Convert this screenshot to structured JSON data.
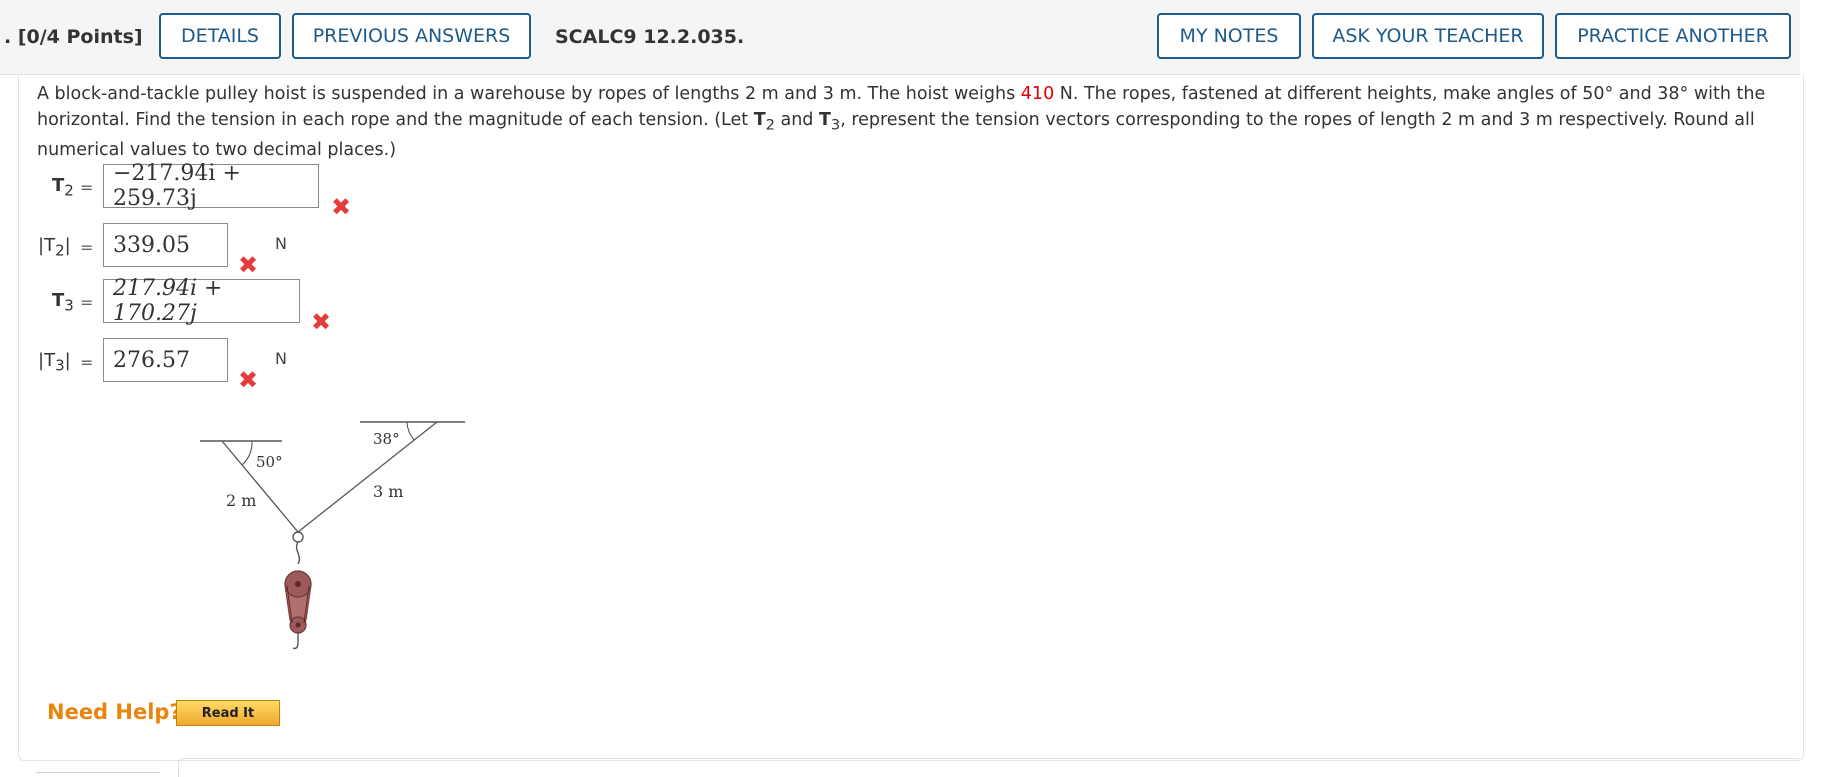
{
  "header": {
    "points": ". [0/4 Points]",
    "details_label": "DETAILS",
    "previous_answers_label": "PREVIOUS ANSWERS",
    "question_id": "SCALC9 12.2.035.",
    "my_notes_label": "MY NOTES",
    "ask_teacher_label": "ASK YOUR TEACHER",
    "practice_another_label": "PRACTICE ANOTHER"
  },
  "problem": {
    "text_part1": "A block-and-tackle pulley hoist is suspended in a warehouse by ropes of lengths 2 m and 3 m. The hoist weighs ",
    "weight": "410",
    "text_part2": " N. The ropes, fastened at different heights, make angles of 50° and 38° with the horizontal. Find the tension in each rope and the magnitude of each tension. (Let ",
    "t2": "T",
    "t2_sub": "2",
    "mid": " and ",
    "t3": "T",
    "t3_sub": "3",
    "text_part3": ", represent the tension vectors corresponding to the ropes of length 2 m and 3 m respectively. Round all numerical values to two decimal places.)"
  },
  "answers": {
    "t2_label": "T",
    "t2_sub": "2",
    "t2_value": "−217.94i + 259.73j",
    "t2_mag_label_left": "|T",
    "t2_mag_sub": "2",
    "t2_mag_label_right": "|",
    "t2_mag_value": "339.05",
    "t3_label": "T",
    "t3_sub": "3",
    "t3_value": "217.94i + 170.27j",
    "t3_mag_label_left": "|T",
    "t3_mag_sub": "3",
    "t3_mag_label_right": "|",
    "t3_mag_value": "276.57",
    "equals": "=",
    "unit": "N",
    "wrong_mark": "✖"
  },
  "figure": {
    "angle_left": "50°",
    "angle_right": "38°",
    "length_left": "2 m",
    "length_right": "3 m"
  },
  "help": {
    "need_help": "Need Help?",
    "read_it": "Read It"
  },
  "colors": {
    "button_border": "#1e5a8a",
    "wrong": "#e23c3c",
    "highlight": "#e00000",
    "need_help": "#e8850a"
  }
}
